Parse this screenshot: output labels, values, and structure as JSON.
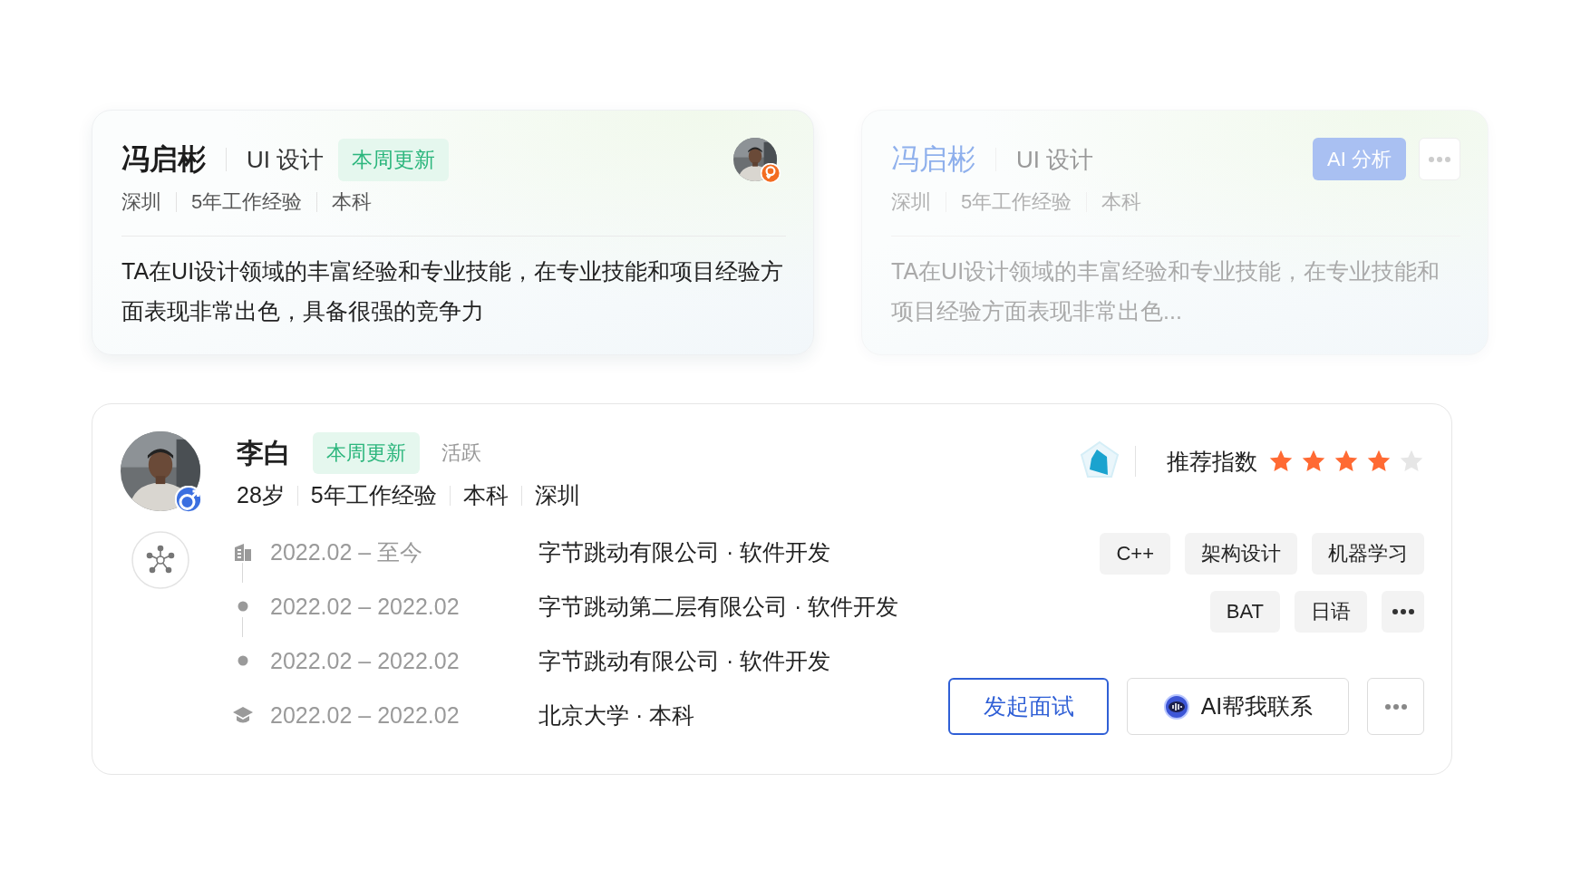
{
  "summary_cards": [
    {
      "dimmed": false,
      "name": "冯启彬",
      "role": "UI 设计",
      "badge": "本周更新",
      "meta": [
        "深圳",
        "5年工作经验",
        "本科"
      ],
      "summary": "TA在UI设计领域的丰富经验和专业技能，在专业技能和项目经验方面表现非常出色，具备很强的竞争力",
      "avatar": {
        "kind": "picture",
        "male": false
      }
    },
    {
      "dimmed": true,
      "name": "冯启彬",
      "role": "UI 设计",
      "meta": [
        "深圳",
        "5年工作经验",
        "本科"
      ],
      "summary": "TA在UI设计领域的丰富经验和专业技能，在专业技能和项目经验方面表现非常出色...",
      "action": "AI 分析"
    }
  ],
  "candidate": {
    "avatar": {
      "kind": "picture",
      "male": true
    },
    "name": "李白",
    "badge": "本周更新",
    "status": "活跃",
    "meta": [
      "28岁",
      "5年工作经验",
      "本科",
      "深圳"
    ],
    "score_label": "推荐指数",
    "stars": 4,
    "timeline": [
      {
        "kind": "current",
        "period": "2022.02 – 至今",
        "title": "字节跳动有限公司 · 软件开发"
      },
      {
        "kind": "past",
        "period": "2022.02 – 2022.02",
        "title": "字节跳动第二层有限公司 · 软件开发"
      },
      {
        "kind": "past",
        "period": "2022.02 – 2022.02",
        "title": "字节跳动有限公司 · 软件开发"
      },
      {
        "kind": "education",
        "period": "2022.02 – 2022.02",
        "title": "北京大学 · 本科"
      }
    ],
    "tags": [
      "C++",
      "架构设计",
      "机器学习",
      "BAT",
      "日语"
    ],
    "buttons": [
      {
        "kind": "primary",
        "label": "发起面试"
      },
      {
        "kind": "ai",
        "label": "AI帮我联系"
      },
      {
        "kind": "more"
      }
    ]
  }
}
